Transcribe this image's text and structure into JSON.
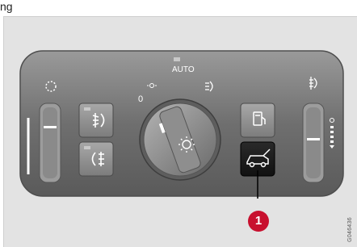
{
  "header": {
    "text_fragment": "ng"
  },
  "labels": {
    "position_zero": "0",
    "position_auto": "AUTO"
  },
  "icons": {
    "dimmer_left": "sun-dimmer-icon",
    "front_fog": "front-fog-light-icon",
    "rear_fog": "rear-fog-light-icon",
    "rotary_knob_symbol": "sun-icon",
    "parking_lights": "parking-light-icon",
    "main_beam": "main-beam-icon",
    "beam_right": "headlight-height-icon",
    "fuel_filler": "fuel-filler-icon",
    "tailgate": "tailgate-icon"
  },
  "callout": {
    "number": "1"
  },
  "figure_code": "G046436",
  "colors": {
    "background": "#e3e3e3",
    "panel": "#7a7a7a",
    "button": "#8d8d8d",
    "highlight_button": "#1c1c1c",
    "callout": "#c8102e"
  }
}
